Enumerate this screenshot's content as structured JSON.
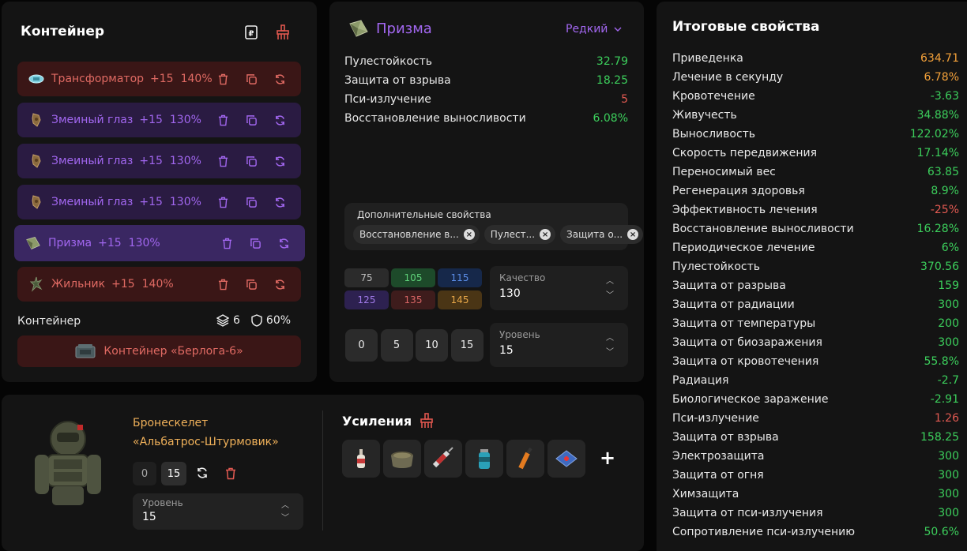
{
  "container": {
    "title": "Контейнер",
    "items": [
      {
        "name": "Трансформатор",
        "plus": "+15",
        "pct": "140%",
        "style": "red",
        "icon": "transformer-artifact-icon"
      },
      {
        "name": "Змеиный глаз",
        "plus": "+15",
        "pct": "130%",
        "style": "purple",
        "icon": "snake-eye-artifact-icon"
      },
      {
        "name": "Змеиный глаз",
        "plus": "+15",
        "pct": "130%",
        "style": "purple",
        "icon": "snake-eye-artifact-icon"
      },
      {
        "name": "Змеиный глаз",
        "plus": "+15",
        "pct": "130%",
        "style": "purple",
        "icon": "snake-eye-artifact-icon"
      },
      {
        "name": "Призма",
        "plus": "+15",
        "pct": "130%",
        "style": "selected",
        "icon": "prism-artifact-icon"
      },
      {
        "name": "Жильник",
        "plus": "+15",
        "pct": "140%",
        "style": "red",
        "icon": "zhilnik-artifact-icon"
      }
    ],
    "footer_label": "Контейнер",
    "slots": "6",
    "protection": "60%",
    "container_button": "Контейнер «Берлога-6»"
  },
  "item": {
    "title": "Призма",
    "rarity": "Редкий",
    "stats": [
      {
        "label": "Пулестойкость",
        "value": "32.79",
        "color": "green"
      },
      {
        "label": "Защита от взрыва",
        "value": "18.25",
        "color": "green"
      },
      {
        "label": "Пси-излучение",
        "value": "5",
        "color": "red"
      },
      {
        "label": "Восстановление выносливости",
        "value": "6.08%",
        "color": "green"
      }
    ],
    "extra_title": "Дополнительные свойства",
    "extra_chips": [
      "Восстановление в...",
      "Пулест...",
      "Защита о..."
    ],
    "quality_buttons": [
      {
        "label": "75",
        "bg": "#2b2b2b",
        "fg": "#bbbbbb"
      },
      {
        "label": "105",
        "bg": "#1d4a2a",
        "fg": "#5fd27a"
      },
      {
        "label": "115",
        "bg": "#16284a",
        "fg": "#5b8ee8"
      },
      {
        "label": "125",
        "bg": "#2d2150",
        "fg": "#a07ae8"
      },
      {
        "label": "135",
        "bg": "#3e1c1c",
        "fg": "#d86565"
      },
      {
        "label": "145",
        "bg": "#4a3515",
        "fg": "#e8a848"
      }
    ],
    "quality_label": "Качество",
    "quality_value": "130",
    "level_buttons": [
      "0",
      "5",
      "10",
      "15"
    ],
    "level_label": "Уровень",
    "level_value": "15"
  },
  "stats": {
    "title": "Итоговые свойства",
    "rows": [
      {
        "label": "Приведенка",
        "value": "634.71",
        "color": "orange"
      },
      {
        "label": "Лечение в секунду",
        "value": "6.78%",
        "color": "orange"
      },
      {
        "label": "Кровотечение",
        "value": "-3.63",
        "color": "green"
      },
      {
        "label": "Живучесть",
        "value": "34.88%",
        "color": "green"
      },
      {
        "label": "Выносливость",
        "value": "122.02%",
        "color": "green"
      },
      {
        "label": "Скорость передвижения",
        "value": "17.14%",
        "color": "green"
      },
      {
        "label": "Переносимый вес",
        "value": "63.85",
        "color": "green"
      },
      {
        "label": "Регенерация здоровья",
        "value": "8.9%",
        "color": "green"
      },
      {
        "label": "Эффективность лечения",
        "value": "-25%",
        "color": "red"
      },
      {
        "label": "Восстановление выносливости",
        "value": "16.28%",
        "color": "green"
      },
      {
        "label": "Периодическое лечение",
        "value": "6%",
        "color": "green"
      },
      {
        "label": "Пулестойкость",
        "value": "370.56",
        "color": "green"
      },
      {
        "label": "Защита от разрыва",
        "value": "159",
        "color": "green"
      },
      {
        "label": "Защита от радиации",
        "value": "300",
        "color": "green"
      },
      {
        "label": "Защита от температуры",
        "value": "200",
        "color": "green"
      },
      {
        "label": "Защита от биозаражения",
        "value": "300",
        "color": "green"
      },
      {
        "label": "Защита от кровотечения",
        "value": "55.8%",
        "color": "green"
      },
      {
        "label": "Радиация",
        "value": "-2.7",
        "color": "green"
      },
      {
        "label": "Биологическое заражение",
        "value": "-2.91",
        "color": "green"
      },
      {
        "label": "Пси-излучение",
        "value": "1.26",
        "color": "red"
      },
      {
        "label": "Защита от взрыва",
        "value": "158.25",
        "color": "green"
      },
      {
        "label": "Электрозащита",
        "value": "300",
        "color": "green"
      },
      {
        "label": "Защита от огня",
        "value": "300",
        "color": "green"
      },
      {
        "label": "Химзащита",
        "value": "300",
        "color": "green"
      },
      {
        "label": "Защита от пси-излучения",
        "value": "300",
        "color": "green"
      },
      {
        "label": "Сопротивление пси-излучению",
        "value": "50.6%",
        "color": "green"
      }
    ]
  },
  "armor": {
    "name_line1": "Бронескелет",
    "name_line2": "«Альбатрос-Штурмовик»",
    "level_buttons": [
      "0",
      "15"
    ],
    "level_label": "Уровень",
    "level_value": "15",
    "boosts_title": "Усиления",
    "boost_icons": [
      "bottle-icon",
      "pot-icon",
      "syringe-icon",
      "canister-icon",
      "vial-icon",
      "medkit-icon"
    ],
    "add_label": "+"
  },
  "colors": {
    "green": "#3ccf5c",
    "orange": "#f5a23a",
    "red": "#e35a52",
    "purple": "#a267f0",
    "armor_name": "#f0b15a"
  }
}
